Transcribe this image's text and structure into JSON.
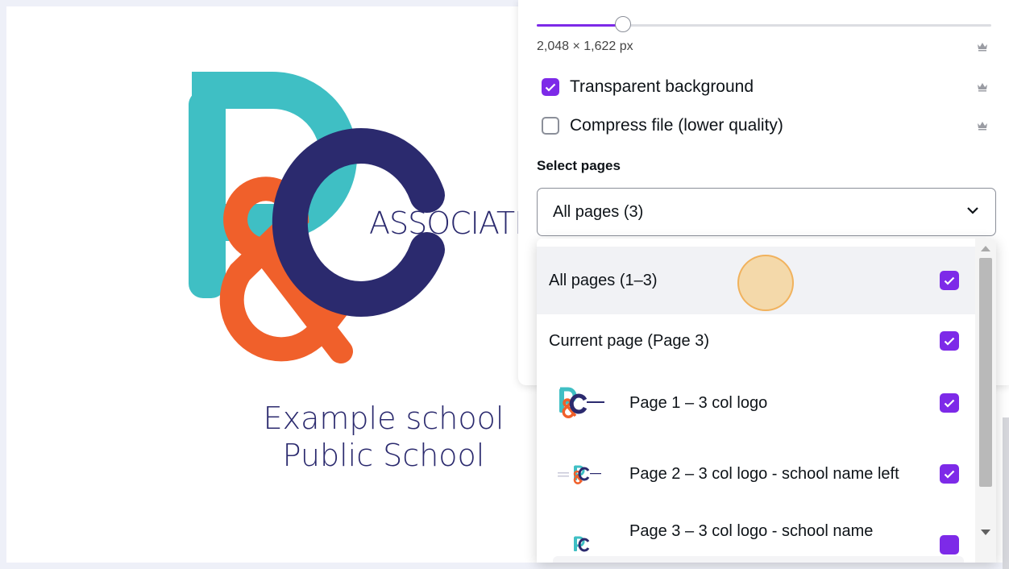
{
  "canvas": {
    "logo_word": "ASSOCIATIO",
    "school_line1": "Example school",
    "school_line2": "Public School",
    "colors": {
      "teal": "#3fbfc4",
      "orange": "#f0602b",
      "navy": "#2b2a6e"
    }
  },
  "panel": {
    "size_slider_fraction": 0.19,
    "dimensions": "2,048 × 1,622 px",
    "options": [
      {
        "label": "Transparent background",
        "checked": true,
        "premium": true
      },
      {
        "label": "Compress file (lower quality)",
        "checked": false,
        "premium": true
      }
    ],
    "dims_premium": true,
    "select_pages_label": "Select pages",
    "select_value": "All pages (3)",
    "accent": "#7d2ae8"
  },
  "dropdown": {
    "items": [
      {
        "label": "All pages (1–3)",
        "checked": true
      },
      {
        "label": "Current page (Page 3)",
        "checked": true
      },
      {
        "label": "Page 1 – 3 col logo",
        "checked": true,
        "thumbnail": "P&C logo"
      },
      {
        "label": "Page 2 – 3 col logo - school name left",
        "checked": true,
        "thumbnail": "P&C logo small"
      },
      {
        "label": "Page 3 – 3 col logo - school name",
        "checked": true,
        "thumbnail": "P&C logo small"
      }
    ]
  }
}
